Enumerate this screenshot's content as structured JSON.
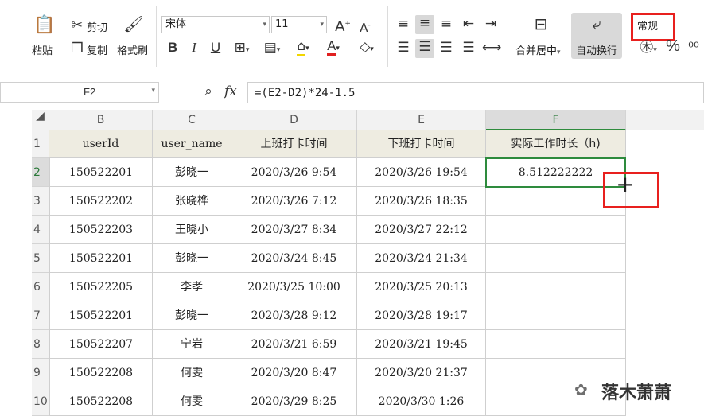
{
  "ribbon": {
    "paste_label": "粘贴",
    "cut_label": "剪切",
    "copy_label": "复制",
    "format_painter_label": "格式刷",
    "font_name": "宋体",
    "font_size": "11",
    "bold": "B",
    "italic": "I",
    "underline": "U",
    "merge_center_label": "合并居中",
    "wrap_text_label": "自动换行",
    "number_format": "常规",
    "percent": "%"
  },
  "formula_bar": {
    "name_box": "F2",
    "fx": "fx",
    "formula": "=(E2-D2)*24-1.5"
  },
  "columns": [
    "B",
    "C",
    "D",
    "E",
    "F"
  ],
  "row_numbers": [
    "1",
    "2",
    "3",
    "4",
    "5",
    "6",
    "7",
    "8",
    "9",
    "10"
  ],
  "header": [
    "userId",
    "user_name",
    "上班打卡时间",
    "下班打卡时间",
    "实际工作时长（h)"
  ],
  "rows": [
    [
      "150522201",
      "彭晓一",
      "2020/3/26 9:54",
      "2020/3/26 19:54",
      "8.512222222"
    ],
    [
      "150522202",
      "张晓桦",
      "2020/3/26 7:12",
      "2020/3/26 18:35",
      ""
    ],
    [
      "150522203",
      "王晓小",
      "2020/3/27 8:34",
      "2020/3/27 22:12",
      ""
    ],
    [
      "150522201",
      "彭晓一",
      "2020/3/24 8:45",
      "2020/3/24 21:34",
      ""
    ],
    [
      "150522205",
      "李孝",
      "2020/3/25 10:00",
      "2020/3/25 20:13",
      ""
    ],
    [
      "150522201",
      "彭晓一",
      "2020/3/28 9:12",
      "2020/3/28 19:17",
      ""
    ],
    [
      "150522207",
      "宁岩",
      "2020/3/21 6:59",
      "2020/3/21 19:45",
      ""
    ],
    [
      "150522208",
      "何雯",
      "2020/3/20 8:47",
      "2020/3/20 21:37",
      ""
    ],
    [
      "150522208",
      "何雯",
      "2020/3/29 8:25",
      "2020/3/30 1:26",
      ""
    ]
  ],
  "watermark": "落木萧萧"
}
